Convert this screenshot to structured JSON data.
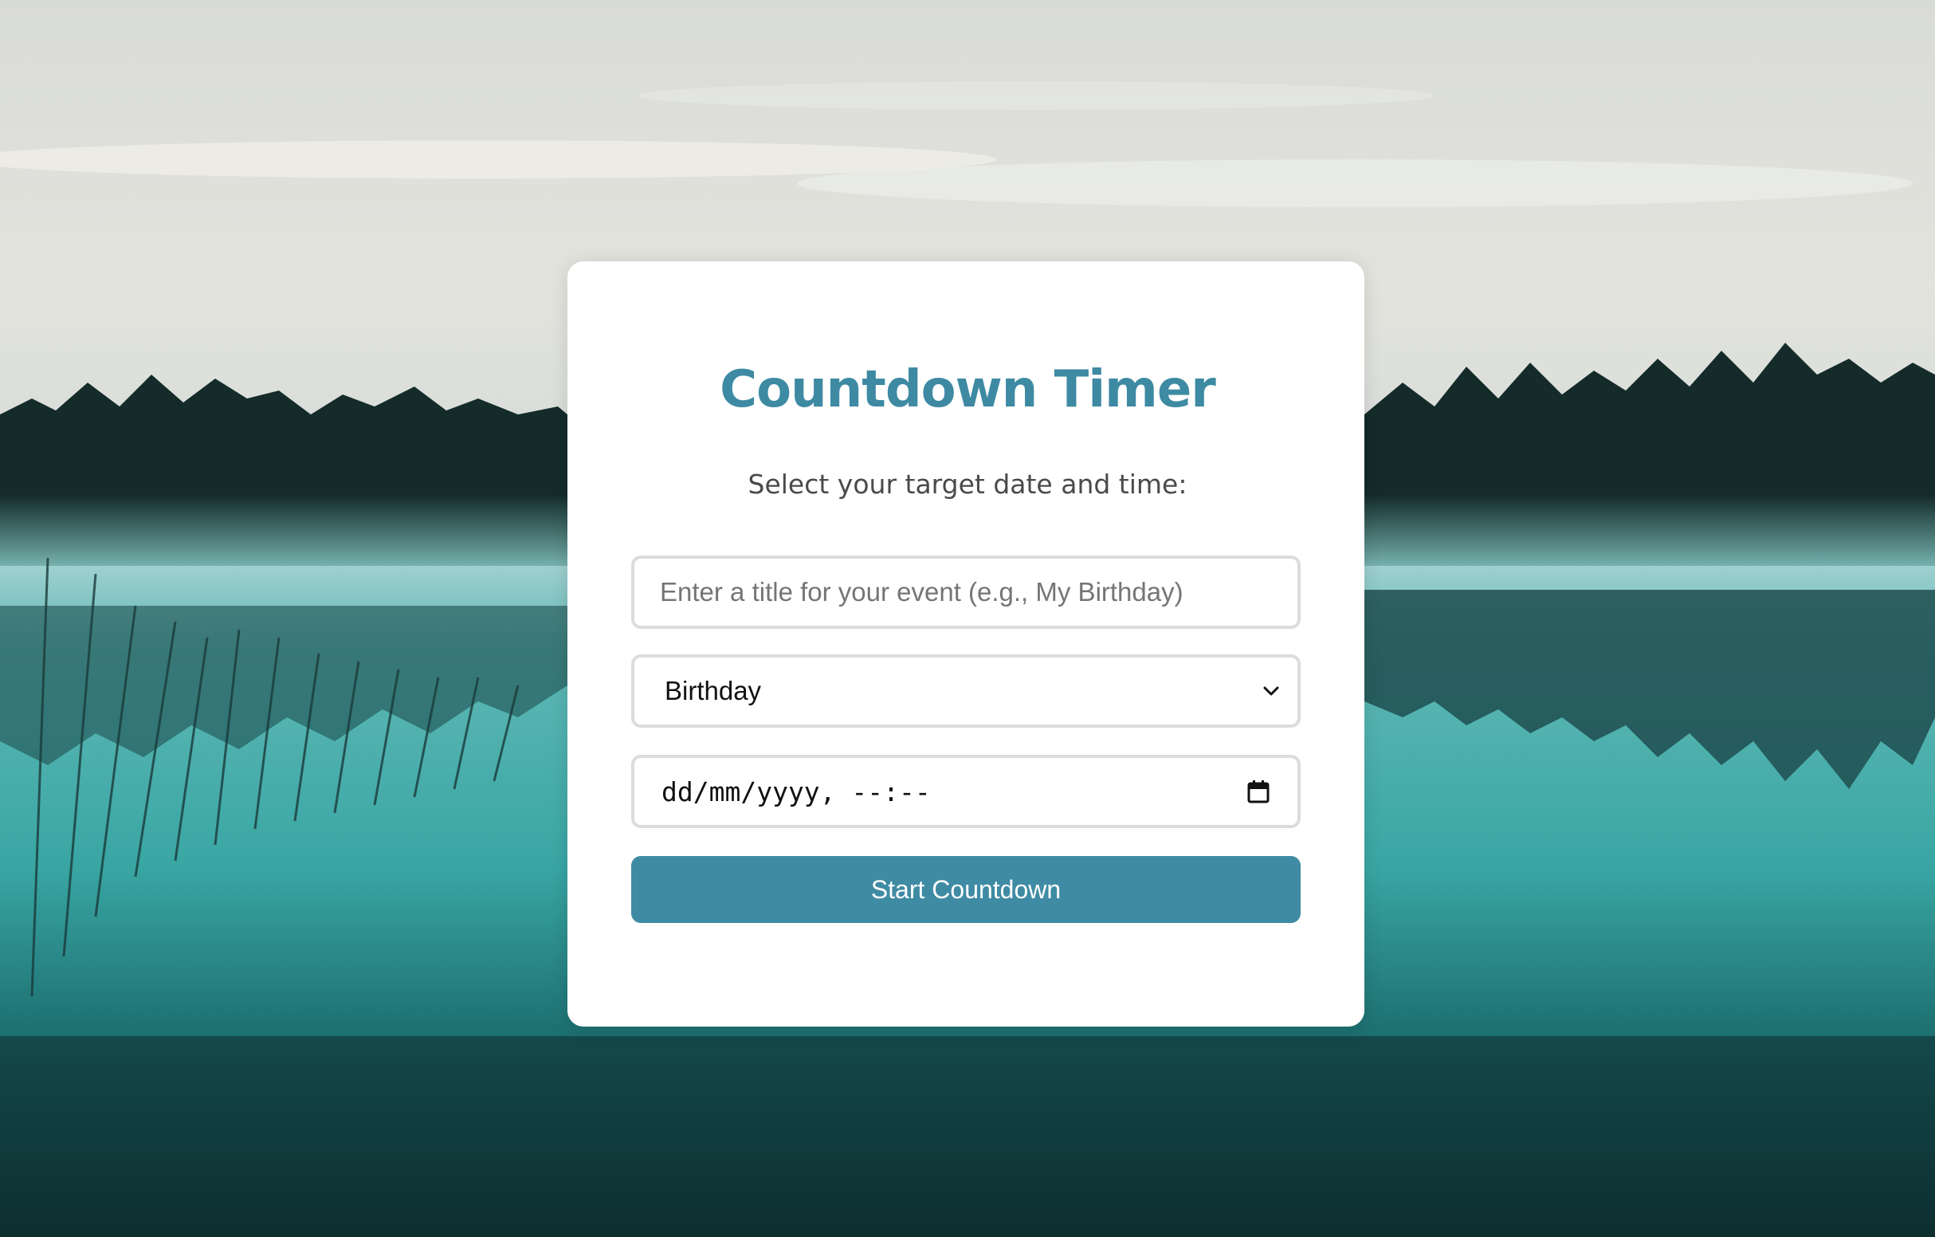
{
  "card": {
    "title": "Countdown Timer",
    "subtitle": "Select your target date and time:"
  },
  "form": {
    "event_title": {
      "value": "",
      "placeholder": "Enter a title for your event (e.g., My Birthday)"
    },
    "event_type": {
      "selected": "Birthday"
    },
    "datetime": {
      "value": "dd/mm/yyyy, --:--"
    },
    "start_label": "Start Countdown"
  },
  "colors": {
    "accent": "#3f8ba4",
    "title": "#3e8aa3",
    "sky": "#dcdfdc",
    "water": "#2a8f8d",
    "forest": "#132827"
  },
  "icons": {
    "select": "chevron-down-icon",
    "date": "calendar-icon"
  }
}
